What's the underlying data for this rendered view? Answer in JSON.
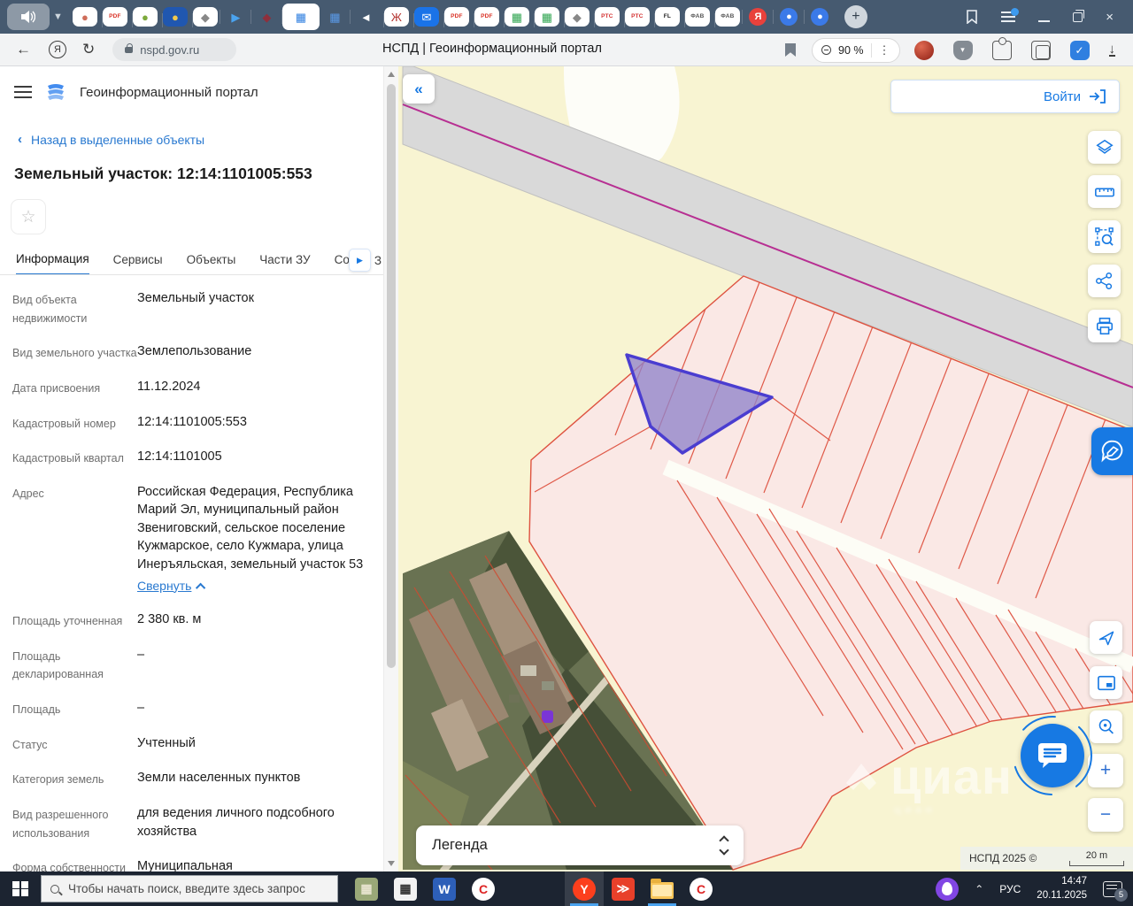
{
  "theme": {
    "accent": "#1779e3",
    "link": "#2979d0",
    "magenta": "#b72f92",
    "pink": "#fae8e5",
    "redline": "#de5240",
    "parcel-fill": "#9184cb",
    "parcel-stroke": "#4a3dd0"
  },
  "browser": {
    "url": "nspd.gov.ru",
    "page_title": "НСПД | Геоинформационный портал",
    "zoom_level": "90 %",
    "new_tab_glyph": "+",
    "tab_icons": [
      {
        "name": "doc-red",
        "bg": "#ffffff",
        "fg": "#cf6d5a",
        "glyph": "●"
      },
      {
        "name": "pdf-1",
        "bg": "#ffffff",
        "fg": "#d93025",
        "glyph": "PDF",
        "txt": true
      },
      {
        "name": "emblem-green",
        "bg": "#ffffff",
        "fg": "#7daa3c",
        "glyph": "●"
      },
      {
        "name": "shield-blue",
        "bg": "#2057b0",
        "fg": "#f2c94c",
        "glyph": "●"
      },
      {
        "name": "emblem-eagle-1",
        "bg": "#ffffff",
        "fg": "#888888",
        "glyph": "◆"
      },
      {
        "name": "yandex-arrow",
        "bg": "",
        "fg": "#4aa3ef",
        "glyph": "▶"
      },
      {
        "name": "ornament-darkred",
        "bg": "",
        "fg": "#8e2f3c",
        "glyph": "◆"
      },
      {
        "name": "doc-blue-active",
        "bg": "#ffffff",
        "fg": "#2f7fe0",
        "glyph": "▦",
        "active": true
      },
      {
        "name": "table-blue",
        "bg": "",
        "fg": "#5a9ae8",
        "glyph": "▦"
      },
      {
        "name": "speaker-small",
        "bg": "",
        "fg": "#ffffff",
        "glyph": "◄"
      },
      {
        "name": "emblem-red",
        "bg": "#ffffff",
        "fg": "#b3322e",
        "glyph": "Ж"
      },
      {
        "name": "mail-blue",
        "bg": "#1a73e8",
        "fg": "#ffffff",
        "glyph": "✉"
      },
      {
        "name": "pdf-2",
        "bg": "#ffffff",
        "fg": "#d93025",
        "glyph": "PDF",
        "txt": true
      },
      {
        "name": "pdf-3",
        "bg": "#ffffff",
        "fg": "#d93025",
        "glyph": "PDF",
        "txt": true
      },
      {
        "name": "map-green-1",
        "bg": "#ffffff",
        "fg": "#2ea44f",
        "glyph": "▦"
      },
      {
        "name": "map-green-2",
        "bg": "#ffffff",
        "fg": "#2ea44f",
        "glyph": "▦"
      },
      {
        "name": "emblem-eagle-2",
        "bg": "#ffffff",
        "fg": "#888888",
        "glyph": "◆"
      },
      {
        "name": "rts-1",
        "bg": "#ffffff",
        "fg": "#d32f2f",
        "glyph": "РТС",
        "txt": true
      },
      {
        "name": "rts-2",
        "bg": "#ffffff",
        "fg": "#d32f2f",
        "glyph": "РТС",
        "txt": true
      },
      {
        "name": "fl",
        "bg": "#ffffff",
        "fg": "#222222",
        "glyph": "FL",
        "txt": true
      },
      {
        "name": "fab-1",
        "bg": "#ffffff",
        "fg": "#555555",
        "glyph": "ФАВ",
        "txt": true
      },
      {
        "name": "fab-2",
        "bg": "#ffffff",
        "fg": "#555555",
        "glyph": "ФАВ",
        "txt": true
      },
      {
        "name": "yandex-ya",
        "bg": "#e8413c",
        "fg": "#ffffff",
        "glyph": "Я",
        "round": true
      },
      {
        "name": "blue-dot-1",
        "bg": "#3b7ae8",
        "fg": "#3b7ae8",
        "glyph": "●",
        "round": true
      },
      {
        "name": "blue-dot-2",
        "bg": "#3b7ae8",
        "fg": "#3b7ae8",
        "glyph": "●",
        "round": true
      }
    ]
  },
  "portal": {
    "app_title": "Геоинформационный портал",
    "back_glyph": "‹",
    "back_link": "Назад в выделенные объекты",
    "object_title": "Земельный участок: 12:14:1101005:553",
    "star_glyph": "☆",
    "tabs": [
      "Информация",
      "Сервисы",
      "Объекты",
      "Части ЗУ",
      "Сост"
    ],
    "active_tab": "Информация",
    "tab_more_glyph": "▶",
    "tab_overflow_char": "З",
    "login_label": "Войти",
    "collapse_btn_glyph": "«",
    "fields": [
      {
        "label": "Вид объекта недвижимости",
        "value": "Земельный участок"
      },
      {
        "label": "Вид земельного участка",
        "value": "Землепользование"
      },
      {
        "label": "Дата присвоения",
        "value": "11.12.2024"
      },
      {
        "label": "Кадастровый номер",
        "value": "12:14:1101005:553"
      },
      {
        "label": "Кадастровый квартал",
        "value": "12:14:1101005"
      },
      {
        "label": "Адрес",
        "value": "Российская Федерация, Республика Марий Эл, муниципальный район Звениговский, сельское поселение Кужмарское, село Кужмара, улица Инеръяльская, земельный участок 53",
        "link": "Свернуть"
      },
      {
        "label": "Площадь уточненная",
        "value": "2 380 кв. м"
      },
      {
        "label": "Площадь декларированная",
        "value": "–"
      },
      {
        "label": "Площадь",
        "value": "–"
      },
      {
        "label": "Статус",
        "value": "Учтенный"
      },
      {
        "label": "Категория земель",
        "value": "Земли населенных пунктов"
      },
      {
        "label": "Вид разрешенного использования",
        "value": "для ведения личного подсобного хозяйства"
      },
      {
        "label": "Форма собственности",
        "value": "Муниципальная"
      }
    ]
  },
  "map": {
    "legend_label": "Легенда",
    "attribution": "НСПД 2025 ©",
    "scale_label": "20 m",
    "watermark": "циан",
    "zoom_in_glyph": "+",
    "zoom_out_glyph": "−"
  },
  "taskbar": {
    "search_placeholder": "Чтобы начать поиск, введите здесь запрос",
    "language": "РУС",
    "time": "14:47",
    "date": "20.11.2025",
    "notification_count": "5",
    "apps": [
      {
        "name": "maps-app",
        "bg": "#9aa878",
        "fg": "#e8e4d0",
        "glyph": "▦"
      },
      {
        "name": "calculator",
        "bg": "#f2f2f2",
        "fg": "#333333",
        "glyph": "▦"
      },
      {
        "name": "word",
        "bg": "#2d5fb8",
        "fg": "#ffffff",
        "glyph": "W"
      },
      {
        "name": "corel-1",
        "bg": "#ffffff",
        "fg": "#dd2222",
        "glyph": "C",
        "round": true
      },
      {
        "name": "yandex-browser",
        "bg": "#fc3f1d",
        "fg": "#ffffff",
        "glyph": "Y",
        "round": true,
        "active": true,
        "highlight": true,
        "gap": true
      },
      {
        "name": "red-arrows",
        "bg": "#e8402a",
        "fg": "#ffffff",
        "glyph": "≫"
      },
      {
        "name": "explorer",
        "folder": true,
        "active": true
      },
      {
        "name": "corel-2",
        "bg": "#ffffff",
        "fg": "#dd2222",
        "glyph": "C",
        "round": true
      }
    ]
  }
}
